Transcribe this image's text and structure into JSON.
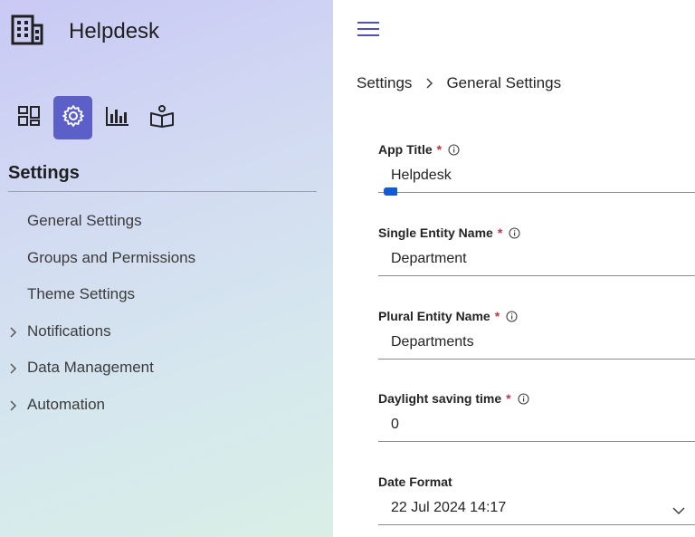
{
  "app": {
    "title": "Helpdesk"
  },
  "sidebar": {
    "brand_icon": "building-icon",
    "icons": [
      {
        "name": "dashboard-icon",
        "active": false
      },
      {
        "name": "settings-icon",
        "active": true
      },
      {
        "name": "chart-icon",
        "active": false
      },
      {
        "name": "book-icon",
        "active": false
      }
    ],
    "section_title": "Settings",
    "items": [
      {
        "label": "General Settings",
        "expandable": false
      },
      {
        "label": "Groups and Permissions",
        "expandable": false
      },
      {
        "label": "Theme Settings",
        "expandable": false
      },
      {
        "label": "Notifications",
        "expandable": true
      },
      {
        "label": "Data Management",
        "expandable": true
      },
      {
        "label": "Automation",
        "expandable": true
      }
    ]
  },
  "header": {
    "menu_icon": "hamburger-icon"
  },
  "breadcrumb": {
    "root": "Settings",
    "current": "General Settings"
  },
  "form": {
    "fields": [
      {
        "label": "App Title",
        "required": true,
        "info": true,
        "value": "Helpdesk"
      },
      {
        "label": "Single Entity Name",
        "required": true,
        "info": true,
        "value": "Department"
      },
      {
        "label": "Plural Entity Name",
        "required": true,
        "info": true,
        "value": "Departments"
      },
      {
        "label": "Daylight saving time",
        "required": true,
        "info": true,
        "value": "0"
      },
      {
        "label": "Date Format",
        "required": false,
        "info": false,
        "value": "22 Jul 2024 14:17"
      }
    ],
    "required_mark": "*"
  },
  "colors": {
    "accent": "#5b5fc7",
    "required": "#c4314b",
    "focus": "#0f5bd8"
  }
}
